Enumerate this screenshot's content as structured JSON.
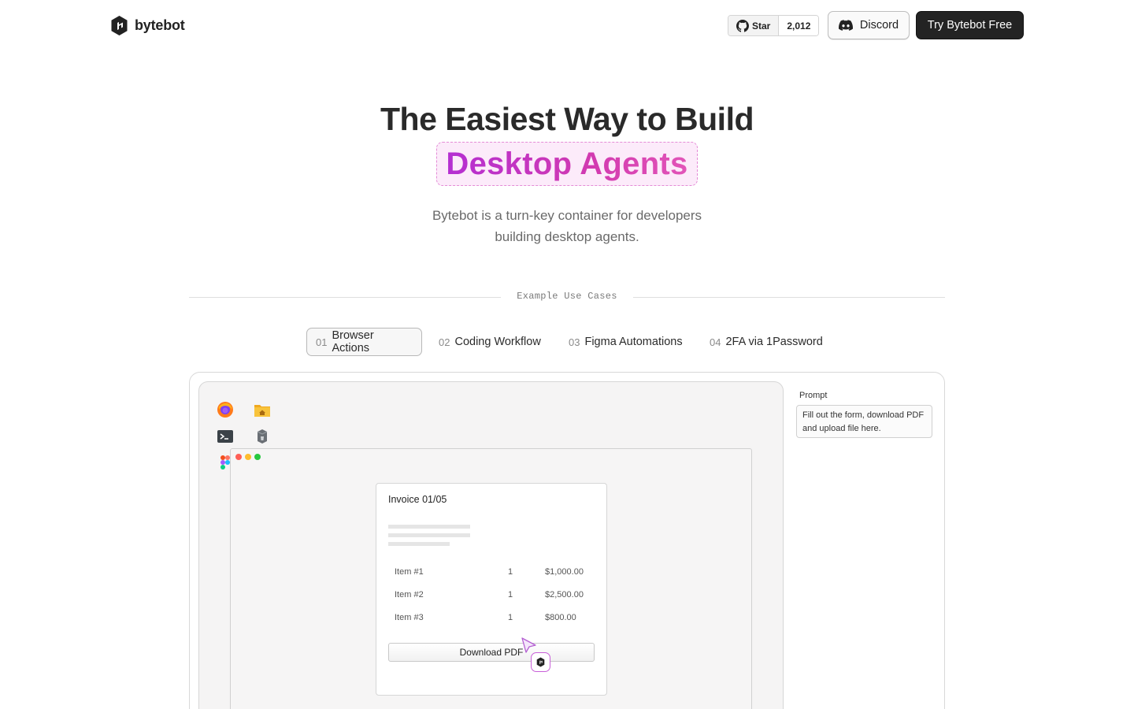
{
  "header": {
    "logo_text": "bytebot",
    "github": {
      "star_label": "Star",
      "star_count": "2,012"
    },
    "discord_label": "Discord",
    "cta_label": "Try Bytebot Free"
  },
  "hero": {
    "title": "The Easiest Way to Build",
    "highlight": "Desktop Agents",
    "subtitle_line1": "Bytebot is a turn-key container for developers",
    "subtitle_line2": "building desktop agents."
  },
  "use_cases": {
    "label": "Example Use Cases",
    "tabs": [
      {
        "num": "01",
        "label": "Browser Actions",
        "active": true
      },
      {
        "num": "02",
        "label": "Coding Workflow",
        "active": false
      },
      {
        "num": "03",
        "label": "Figma Automations",
        "active": false
      },
      {
        "num": "04",
        "label": "2FA via 1Password",
        "active": false
      }
    ]
  },
  "demo": {
    "desktop_icons": [
      "firefox-icon",
      "home-folder-icon",
      "terminal-icon",
      "trash-icon",
      "figma-icon"
    ],
    "invoice": {
      "title": "Invoice 01/05",
      "rows": [
        {
          "item": "Item #1",
          "qty": "1",
          "price": "$1,000.00"
        },
        {
          "item": "Item #2",
          "qty": "1",
          "price": "$2,500.00"
        },
        {
          "item": "Item #3",
          "qty": "1",
          "price": "$800.00"
        }
      ],
      "download_label": "Download PDF"
    },
    "prompt": {
      "label": "Prompt",
      "text": "Fill out the form, download PDF and upload file here."
    }
  },
  "colors": {
    "accent_gradient_start": "#b42fd2",
    "accent_gradient_end": "#e255b8",
    "pill_background": "#fcebfa",
    "cta_background": "#232323"
  }
}
